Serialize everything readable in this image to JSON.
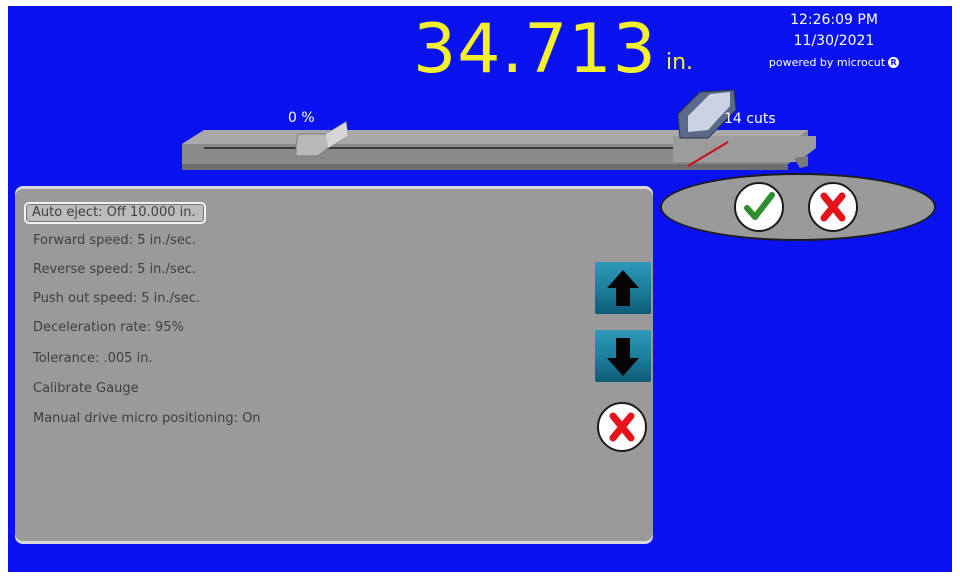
{
  "display": {
    "position_value": "34.713",
    "position_unit": "in.",
    "time": "12:26:09 PM",
    "date": "11/30/2021",
    "brand": "powered by microcut",
    "brand_mark": "R"
  },
  "gauge": {
    "progress_label": "0 %",
    "progress_fraction": 0.0,
    "cuts_label": "14 cuts"
  },
  "settings": {
    "items": [
      {
        "label": "Auto eject: Off  10.000 in.",
        "selected": true
      },
      {
        "label": "Forward speed: 5 in./sec.",
        "selected": false
      },
      {
        "label": "Reverse speed: 5 in./sec.",
        "selected": false
      },
      {
        "label": "Push out speed: 5 in./sec.",
        "selected": false
      },
      {
        "label": "Deceleration rate: 95%",
        "selected": false
      },
      {
        "label": "Tolerance:   .005 in.",
        "selected": false
      },
      {
        "label": "Calibrate Gauge",
        "selected": false
      },
      {
        "label": "Manual drive micro positioning: On",
        "selected": false
      }
    ]
  },
  "icons": {
    "scroll_up": "arrow-up-icon",
    "scroll_down": "arrow-down-icon",
    "cancel_setting": "red-x-icon",
    "accept": "green-check-icon",
    "reject": "red-x-icon"
  },
  "colors": {
    "background": "#0a12f0",
    "readout": "#f3f02a",
    "panel": "#9a9a9a",
    "accept": "#2f8f2f",
    "reject": "#e3151b"
  }
}
